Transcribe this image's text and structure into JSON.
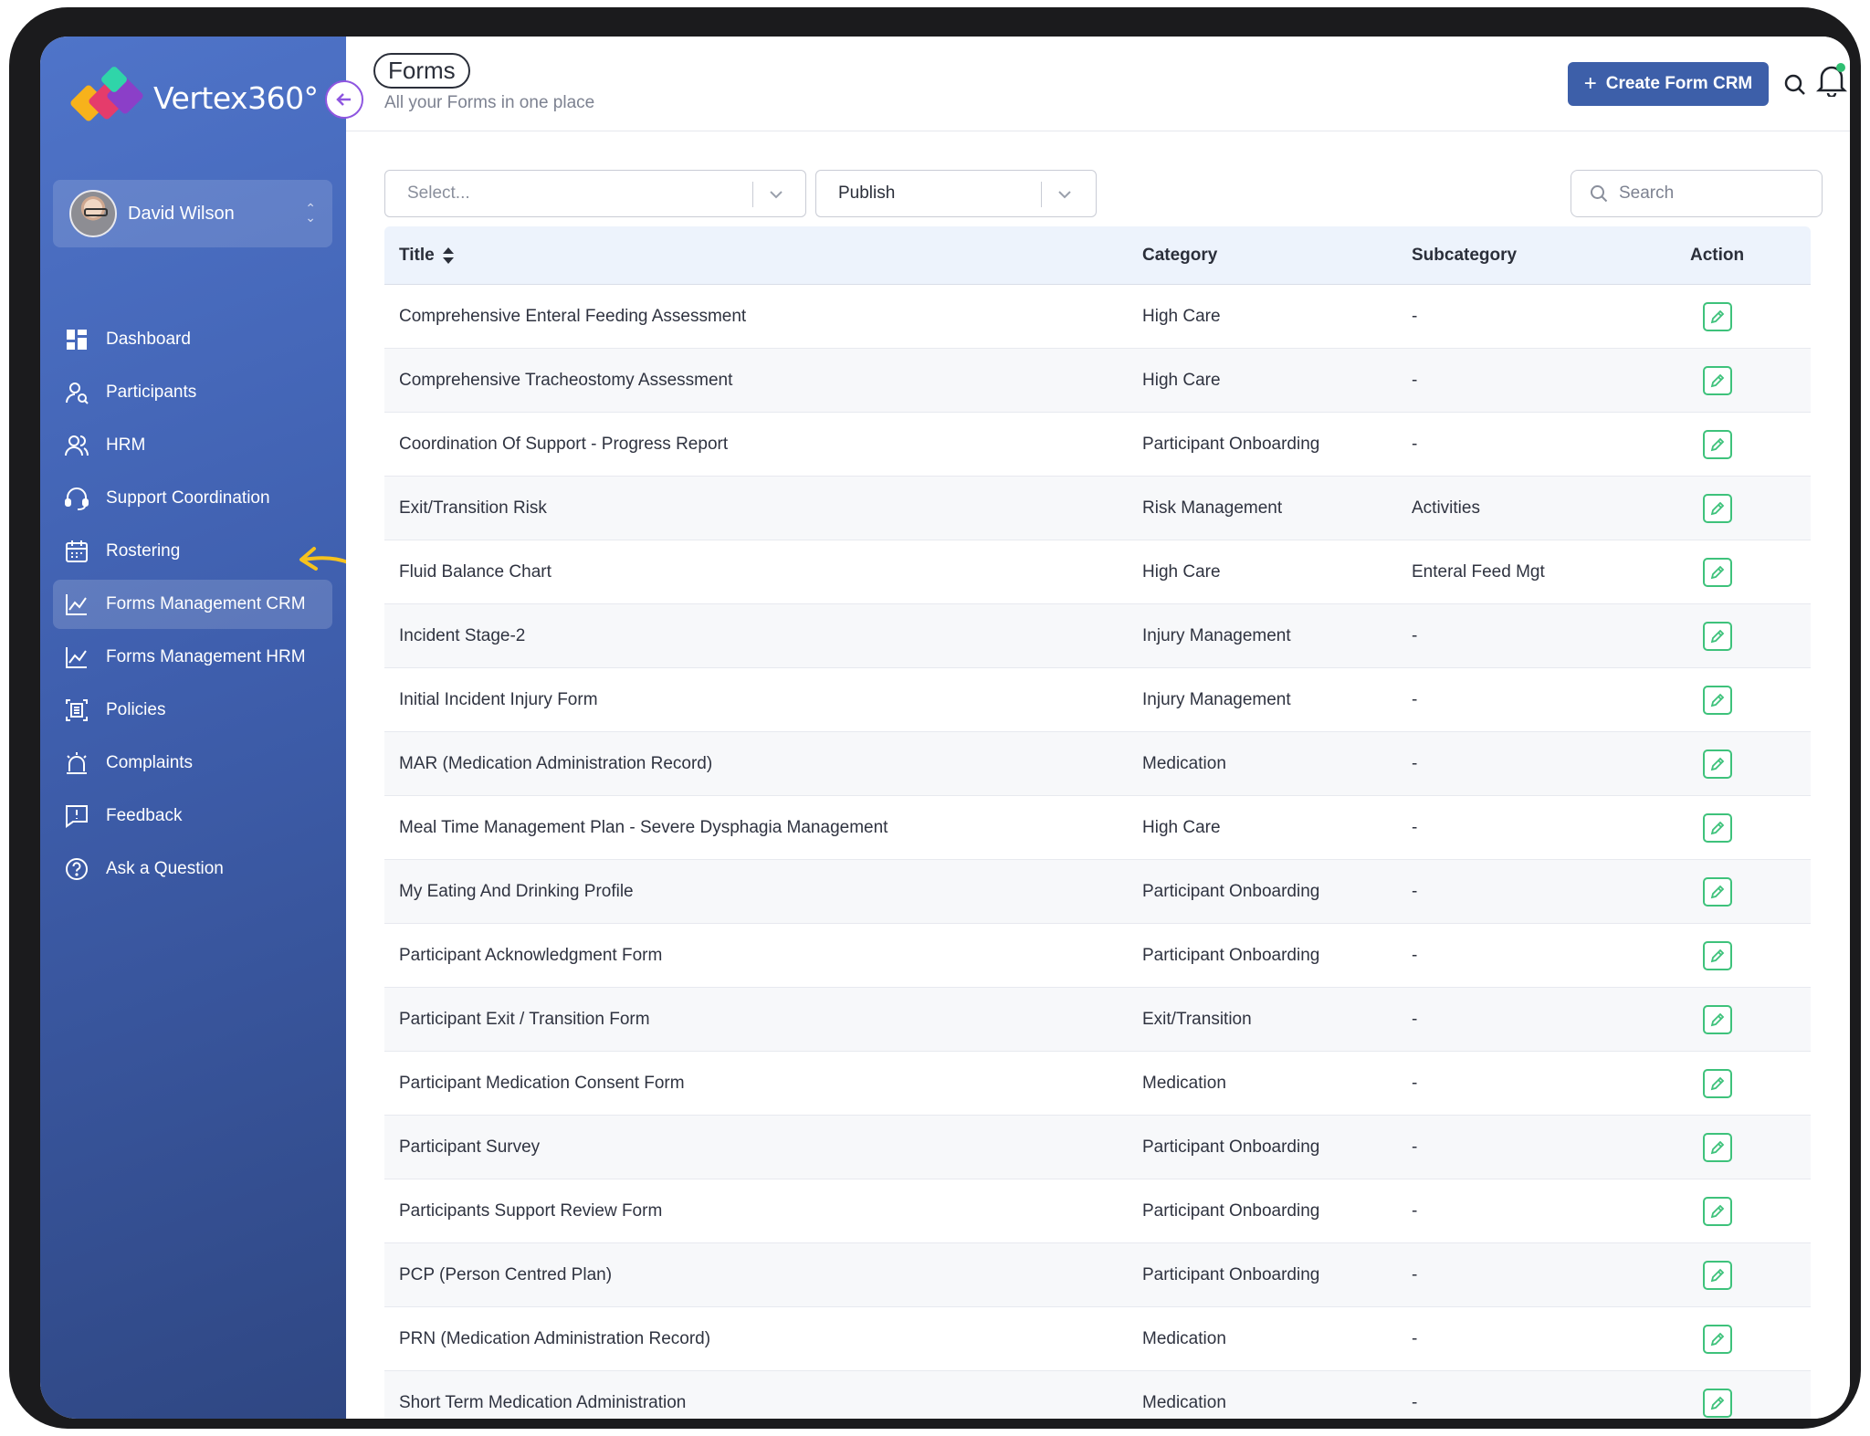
{
  "app": {
    "logo_text": "Vertex360°",
    "colors": {
      "sidebar": "#4f74c9",
      "accent": "#3d5fa9",
      "edit": "#3ec27b",
      "highlight_arrow": "#f6c21d"
    }
  },
  "user": {
    "name": "David Wilson"
  },
  "sidebar": {
    "items": [
      {
        "label": "Dashboard",
        "icon": "dashboard-icon"
      },
      {
        "label": "Participants",
        "icon": "participants-icon"
      },
      {
        "label": "HRM",
        "icon": "users-icon"
      },
      {
        "label": "Support Coordination",
        "icon": "headset-icon"
      },
      {
        "label": "Rostering",
        "icon": "calendar-icon"
      },
      {
        "label": "Forms Management CRM",
        "icon": "chart-icon",
        "active": true
      },
      {
        "label": "Forms Management HRM",
        "icon": "chart-icon"
      },
      {
        "label": "Policies",
        "icon": "document-icon"
      },
      {
        "label": "Complaints",
        "icon": "alarm-icon"
      },
      {
        "label": "Feedback",
        "icon": "message-icon"
      },
      {
        "label": "Ask a Question",
        "icon": "question-icon"
      }
    ]
  },
  "header": {
    "title": "Forms",
    "subtitle": "All your Forms in one place",
    "create_button": "Create Form CRM"
  },
  "filters": {
    "category_placeholder": "Select...",
    "status_value": "Publish",
    "search_placeholder": "Search"
  },
  "table": {
    "columns": {
      "title": "Title",
      "category": "Category",
      "subcategory": "Subcategory",
      "action": "Action"
    },
    "rows": [
      {
        "title": "Comprehensive Enteral Feeding Assessment",
        "category": "High Care",
        "subcategory": "-"
      },
      {
        "title": "Comprehensive Tracheostomy Assessment",
        "category": "High Care",
        "subcategory": "-"
      },
      {
        "title": "Coordination Of Support - Progress Report",
        "category": "Participant Onboarding",
        "subcategory": "-"
      },
      {
        "title": "Exit/Transition Risk",
        "category": "Risk Management",
        "subcategory": "Activities"
      },
      {
        "title": "Fluid Balance Chart",
        "category": "High Care",
        "subcategory": "Enteral Feed Mgt"
      },
      {
        "title": "Incident Stage-2",
        "category": "Injury Management",
        "subcategory": "-"
      },
      {
        "title": "Initial Incident Injury Form",
        "category": "Injury Management",
        "subcategory": "-"
      },
      {
        "title": "MAR (Medication Administration Record)",
        "category": "Medication",
        "subcategory": "-"
      },
      {
        "title": "Meal Time Management Plan - Severe Dysphagia Management",
        "category": "High Care",
        "subcategory": "-"
      },
      {
        "title": "My Eating And Drinking Profile",
        "category": "Participant Onboarding",
        "subcategory": "-"
      },
      {
        "title": "Participant Acknowledgment Form",
        "category": "Participant Onboarding",
        "subcategory": "-"
      },
      {
        "title": "Participant Exit / Transition Form",
        "category": "Exit/Transition",
        "subcategory": "-"
      },
      {
        "title": "Participant Medication Consent Form",
        "category": "Medication",
        "subcategory": "-"
      },
      {
        "title": "Participant Survey",
        "category": "Participant Onboarding",
        "subcategory": "-"
      },
      {
        "title": "Participants Support Review Form",
        "category": "Participant Onboarding",
        "subcategory": "-"
      },
      {
        "title": "PCP (Person Centred Plan)",
        "category": "Participant Onboarding",
        "subcategory": "-"
      },
      {
        "title": "PRN (Medication Administration Record)",
        "category": "Medication",
        "subcategory": "-"
      },
      {
        "title": "Short Term Medication Administration",
        "category": "Medication",
        "subcategory": "-"
      }
    ]
  }
}
